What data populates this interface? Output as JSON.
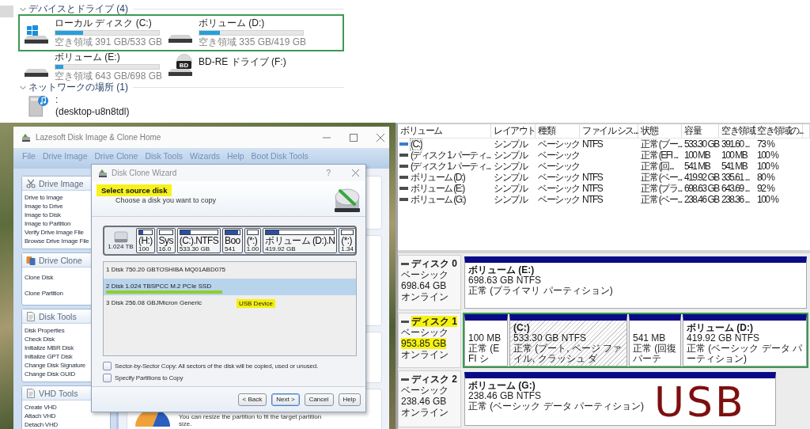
{
  "explorer": {
    "sections": [
      {
        "title": "デバイスとドライブ (4)",
        "expanded": true,
        "rows": [
          {
            "boxed": true,
            "items": [
              {
                "kind": "system_drive",
                "name": "ローカル ディスク (C:)",
                "level": 0.27,
                "free": "空き領域 391 GB/533 GB"
              },
              {
                "kind": "drive",
                "name": "ボリューム (D:)",
                "level": 0.2,
                "free": "空き領域 335 GB/419 GB"
              }
            ]
          },
          {
            "boxed": false,
            "items": [
              {
                "kind": "drive",
                "name": "ボリューム (E:)",
                "level": 0.08,
                "free": "空き領域 643 GB/698 GB"
              },
              {
                "kind": "optical",
                "name": "BD-RE ドライブ (F:)",
                "icon_label": "BD"
              }
            ]
          }
        ]
      },
      {
        "title": "ネットワークの場所 (1)",
        "expanded": true,
        "rows": [
          {
            "boxed": false,
            "items": [
              {
                "kind": "network",
                "name": ":",
                "host": "(desktop-u8n8tdl)"
              }
            ]
          }
        ]
      }
    ]
  },
  "lazesoft": {
    "title": "Lazesoft Disk Image & Clone Home",
    "menu": [
      "File",
      "Drive Image",
      "Drive Clone",
      "Disk Tools",
      "Wizards",
      "Help",
      "Boot Disk Tools"
    ],
    "sidebar": [
      {
        "kind": "image",
        "title": "Drive Image",
        "items": [
          "Drive to Image",
          "Image to Drive",
          "Image to Disk",
          "Image to Partition",
          "Verify Drive Image File",
          "Browse Drive Image File"
        ]
      },
      {
        "kind": "clone",
        "title": "Drive Clone",
        "items": [
          "Clone Disk",
          "Clone Partition"
        ]
      },
      {
        "kind": "tools",
        "title": "Disk Tools",
        "items": [
          "Disk Properties",
          "Check Disk",
          "Initialize MBR Disk",
          "Initialize GPT Disk",
          "Change Disk Signature",
          "Change Disk GUID"
        ]
      },
      {
        "kind": "tools",
        "title": "VHD Tools",
        "items": [
          "Create VHD",
          "Attach VHD",
          "Detach VHD"
        ]
      }
    ],
    "tip": "You can resize the partition to fit the target partition size.",
    "wizard": {
      "title": "Disk Clone Wizard",
      "help_button": "?",
      "heading": "Select source disk",
      "heading_highlighted": true,
      "subheading": "Choose a disk you want to copy",
      "disk_map": {
        "size": "1.024 TB",
        "partitions": [
          {
            "label": "(H:)",
            "size": "100",
            "level": 0.35
          },
          {
            "label": "Sys",
            "size": "16.0",
            "level": 0
          },
          {
            "label": "(C:).NTFS",
            "size": "533.30 GB",
            "level": 0.27
          },
          {
            "label": "Boo",
            "size": "541",
            "level": 0.9
          },
          {
            "label": "(*:)",
            "size": "1.00",
            "level": 0
          },
          {
            "label": "ボリューム (D:).N",
            "size": "419.92 GB",
            "level": 0.2
          },
          {
            "label": "(*:)",
            "size": "1.34",
            "level": 0
          }
        ]
      },
      "disks": [
        {
          "label": "1 Disk 750.20 GBTOSHIBA MQ01ABD075",
          "selected": false,
          "marked": false
        },
        {
          "label": "2 Disk 1.024 TBSPCC M.2 PCIe SSD",
          "selected": true,
          "marked": true
        },
        {
          "label": "3 Disk 256.08 GBJMicron Generic",
          "note": "USB Device",
          "note_highlighted": true,
          "selected": false,
          "marked": false
        }
      ],
      "options": [
        {
          "label": "Sector-by-Sector Copy: All sectors of the disk will be copied, used or unused.",
          "checked": false
        },
        {
          "label": "Specify Partitions to Copy",
          "checked": false
        }
      ],
      "buttons": [
        {
          "label": "< Back",
          "default": false
        },
        {
          "label": "Next >",
          "default": true
        },
        {
          "label": "Cancel",
          "default": false
        },
        {
          "label": "Help",
          "default": false
        }
      ]
    }
  },
  "disk_management": {
    "columns": [
      "ボリューム",
      "レイアウト",
      "種類",
      "ファイル シス...",
      "状態",
      "容量",
      "空き領域",
      "空き領域の..."
    ],
    "rows": [
      {
        "selected": true,
        "volume": "(C:)",
        "layout": "シンプル",
        "type": "ベーシック",
        "file_system": "NTFS",
        "status": "正常 (ブー...",
        "capacity": "533.30 GB",
        "free": "391.60 ...",
        "free_percent": "73 %"
      },
      {
        "selected": false,
        "volume": "(ディスク 1 パーティ...",
        "layout": "シンプル",
        "type": "ベーシック",
        "status": "正常 (EFI ...",
        "capacity": "100 MB",
        "free": "100 MB",
        "free_percent": "100 %"
      },
      {
        "selected": false,
        "volume": "(ディスク 1 パーティ...",
        "layout": "シンプル",
        "type": "ベーシック",
        "status": "正常 (回...",
        "capacity": "541 MB",
        "free": "541 MB",
        "free_percent": "100 %"
      },
      {
        "selected": false,
        "volume": "ボリューム (D:)",
        "layout": "シンプル",
        "type": "ベーシック",
        "file_system": "NTFS",
        "status": "正常 (ベー...",
        "capacity": "419.92 GB",
        "free": "335.61 ...",
        "free_percent": "80 %"
      },
      {
        "selected": false,
        "volume": "ボリューム (E:)",
        "layout": "シンプル",
        "type": "ベーシック",
        "file_system": "NTFS",
        "status": "正常 (プラ...",
        "capacity": "698.63 GB",
        "free": "643.69 ...",
        "free_percent": "92 %"
      },
      {
        "selected": false,
        "volume": "ボリューム (G:)",
        "layout": "シンプル",
        "type": "ベーシック",
        "file_system": "NTFS",
        "status": "正常 (ベー...",
        "capacity": "238.46 GB",
        "free": "238.36 ...",
        "free_percent": "100 %"
      }
    ],
    "disks": [
      {
        "name": "ディスク 0",
        "type": "ベーシック",
        "size": "698.64 GB",
        "status": "オンライン",
        "highlighted": false,
        "boxed": false,
        "partitions": [
          {
            "name": "ボリューム (E:)",
            "size": "698.63 GB NTFS",
            "status": "正常 (プライマリ パーティション)",
            "selected": false
          }
        ]
      },
      {
        "name": "ディスク 1",
        "type": "ベーシック",
        "size": "953.85 GB",
        "status": "オンライン",
        "highlighted": true,
        "boxed": true,
        "partitions": [
          {
            "size": "100 MB",
            "status": "正常 (EFI シ",
            "selected": false
          },
          {
            "name": "(C:)",
            "size": "533.30 GB NTFS",
            "status": "正常 (ブート, ページ ファイル, クラッシュ ダ",
            "selected": true
          },
          {
            "size": "541 MB",
            "status": "正常 (回復パーテ",
            "selected": false
          },
          {
            "name": "ボリューム (D:)",
            "size": "419.92 GB NTFS",
            "status": "正常 (ベーシック データ パーティション)",
            "selected": false
          }
        ]
      },
      {
        "name": "ディスク 2",
        "type": "ベーシック",
        "size": "238.46 GB",
        "status": "オンライン",
        "highlighted": false,
        "boxed": false,
        "annotation": "USB",
        "partitions": [
          {
            "name": "ボリューム (G:)",
            "size": "238.46 GB NTFS",
            "status": "正常 (ベーシック データ パーティション)",
            "selected": false
          }
        ]
      }
    ]
  }
}
